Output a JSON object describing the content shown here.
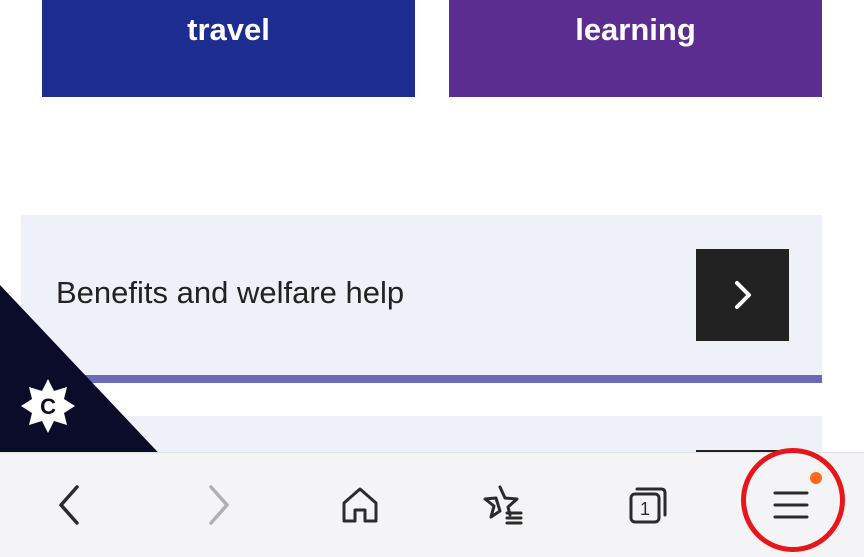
{
  "tiles": {
    "travel": "travel",
    "learning": "learning"
  },
  "cards": {
    "benefits": {
      "title": "Benefits and welfare help"
    }
  },
  "cookie": {
    "badge_letter": "C"
  },
  "toolbar": {
    "tabs_count": "1",
    "menu_has_notification": true
  },
  "colors": {
    "travel_tile": "#1d2d8f",
    "learning_tile": "#5c2d91",
    "card_bg": "#eef1f8",
    "card_bar": "#6b6bb5",
    "arrow_bg": "#222222",
    "notification_dot": "#ff6a1a",
    "highlight_ring": "#e8151b"
  }
}
